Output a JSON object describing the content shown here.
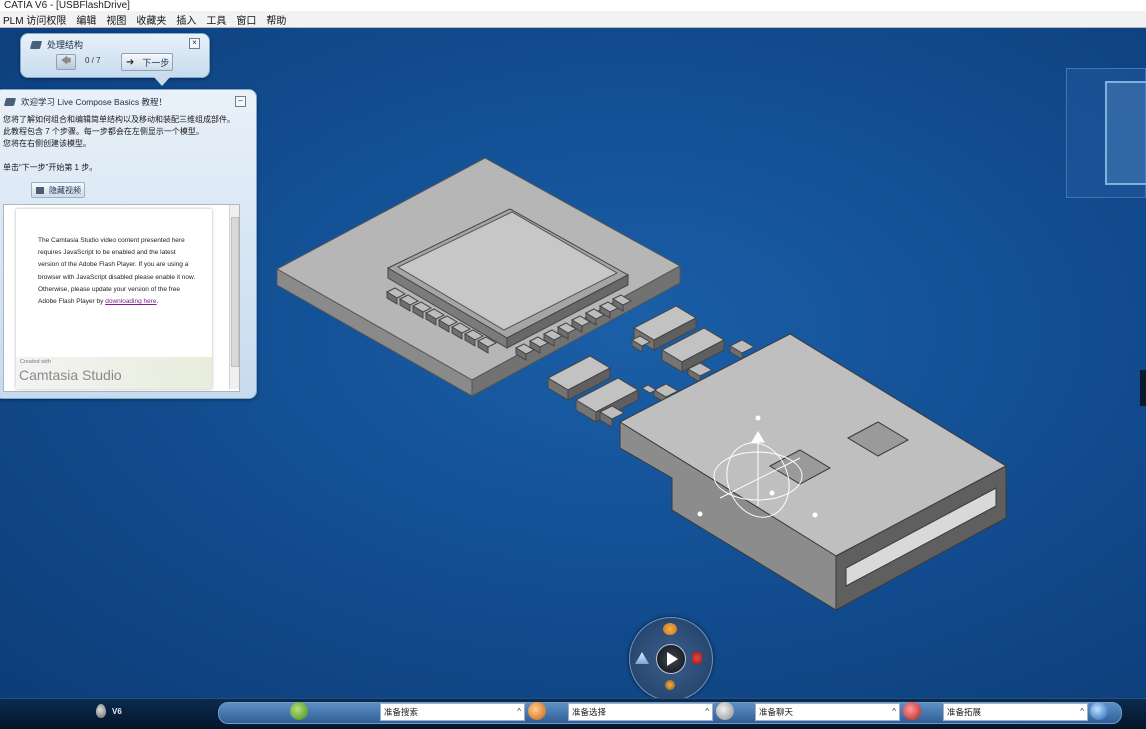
{
  "window": {
    "title": "CATIA V6 - [USBFlashDrive]"
  },
  "menu": {
    "items": [
      "PLM 访问权限",
      "编辑",
      "视图",
      "收藏夹",
      "插入",
      "工具",
      "窗口",
      "帮助"
    ]
  },
  "step_panel": {
    "title": "处理结构",
    "counter": "0 / 7",
    "next_label": "下一步"
  },
  "tutorial": {
    "title": "欢迎学习 Live Compose Basics 教程！",
    "lines": [
      "您将了解如何组合和编辑简单结构以及移动和装配三维组成部件。",
      "此教程包含 7 个步骤。每一步都会在左侧显示一个模型。",
      "您将在右侧创建该模型。",
      "",
      "单击“下一步”开始第 1 步。"
    ],
    "hide_video_label": "隐藏视频",
    "video": {
      "text_before_link": "The Camtasia Studio video content presented here requires JavaScript to be enabled and the latest version of the Adobe Flash Player. If you are using a browser with JavaScript disabled please enable it now. Otherwise, please update your version of the free Adobe Flash Player by",
      "link_text": "downloading here",
      "text_after_link": ".",
      "logo_small": "Created with",
      "logo_big": "Camtasia Studio"
    }
  },
  "taskbar": {
    "brand": "V6",
    "fields": [
      {
        "text": "准备搜索"
      },
      {
        "text": "准备选择"
      },
      {
        "text": "准备聊天"
      },
      {
        "text": "准备拓展"
      }
    ]
  },
  "colors": {
    "viewport_bg": "#134f93",
    "panel_bg": "#d6e5f3",
    "taskbar_bg": "#0b2b4e",
    "model_top": "#b9b9b9",
    "model_side": "#7d7d7d"
  },
  "icons": {
    "step_back": "arrow-left-icon",
    "step_next": "arrow-right-icon",
    "panel_book": "book-icon",
    "robot_center": "play-icon"
  }
}
